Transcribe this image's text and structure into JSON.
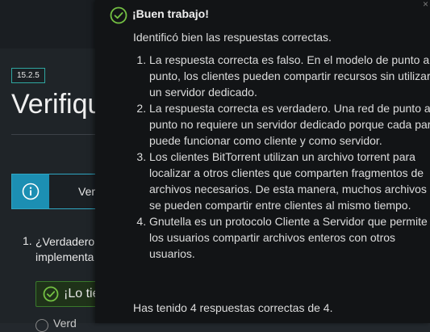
{
  "background": {
    "badge": "15.2.5",
    "title": "Verifique",
    "info_label": "Ver",
    "question_number": "1.",
    "question_lines": [
      "¿Verdadero",
      "implementa"
    ],
    "answer_label": "¡Lo tie",
    "bottom_text": "Verd"
  },
  "popover": {
    "close": "×",
    "title": "¡Buen trabajo!",
    "subtitle": "Identificó bien las respuestas correctas.",
    "items": [
      "La respuesta correcta es falso. En el modelo de punto a punto, los clientes pueden compartir recursos sin utilizar un servidor dedicado.",
      "La respuesta correcta es verdadero. Una red de punto a punto no requiere un servidor dedicado porque cada par puede funcionar como cliente y como servidor.",
      "Los clientes BitTorrent utilizan un archivo torrent para localizar a otros clientes que comparten fragmentos de archivos necesarios. De esta manera, muchos archivos se pueden compartir entre clientes al mismo tiempo.",
      "Gnutella es un protocolo Cliente a Servidor que permite a los usuarios compartir archivos enteros con otros usuarios."
    ],
    "summary": "Has tenido 4 respuestas correctas de 4."
  },
  "colors": {
    "success": "#74c043",
    "accent": "#2fa6c2",
    "info_fill": "#1c8fb3"
  }
}
